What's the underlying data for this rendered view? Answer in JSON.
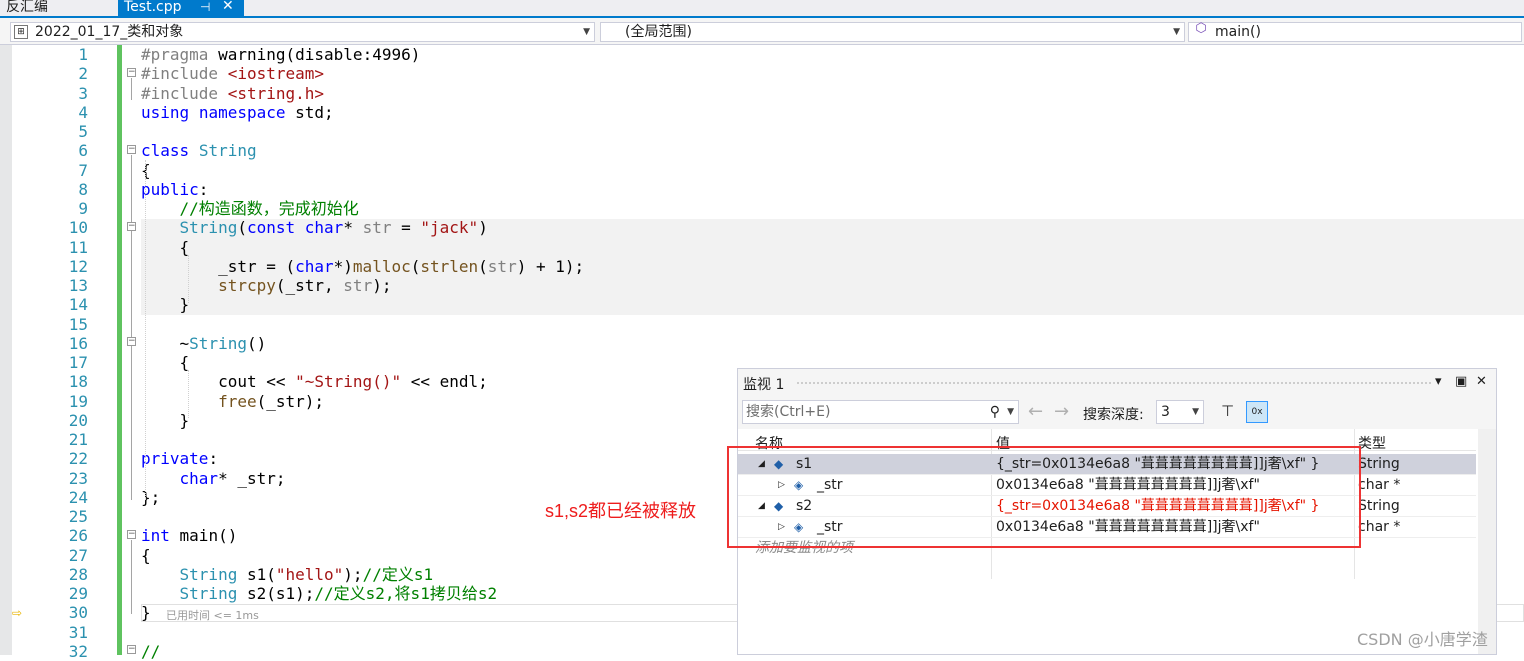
{
  "tabs": [
    {
      "label": "反汇编",
      "active": false
    },
    {
      "label": "Test.cpp",
      "active": true
    }
  ],
  "tab_pin_icon": "pin-icon",
  "tab_close_icon": "close-icon",
  "nav": {
    "project": "2022_01_17_类和对象",
    "scope": "(全局范围)",
    "member": "main()"
  },
  "editor": {
    "line_numbers": [
      "1",
      "2",
      "3",
      "4",
      "5",
      "6",
      "7",
      "8",
      "9",
      "10",
      "11",
      "12",
      "13",
      "14",
      "15",
      "16",
      "17",
      "18",
      "19",
      "20",
      "21",
      "22",
      "23",
      "24",
      "25",
      "26",
      "27",
      "28",
      "29",
      "30",
      "31",
      "32"
    ],
    "lines": [
      "#pragma warning(disable:4996)",
      "#include <iostream>",
      "#include <string.h>",
      "using namespace std;",
      "",
      "class String",
      "{",
      "public:",
      "    //构造函数，完成初始化",
      "    String(const char* str = \"jack\")",
      "    {",
      "        _str = (char*)malloc(strlen(str) + 1);",
      "        strcpy(_str, str);",
      "    }",
      "",
      "    ~String()",
      "    {",
      "        cout << \"~String()\" << endl;",
      "        free(_str);",
      "    }",
      "",
      "private:",
      "    char* _str;",
      "};",
      "",
      "int main()",
      "{",
      "    String s1(\"hello\");//定义s1",
      "    String s2(s1);//定义s2,将s1拷贝给s2",
      "}",
      "",
      "//"
    ],
    "elapsed": "已用时间 <= 1ms"
  },
  "annotation": "s1,s2都已经被释放",
  "watch": {
    "title": "监视 1",
    "search_placeholder": "搜索(Ctrl+E)",
    "depth_label": "搜索深度:",
    "depth_value": "3",
    "headers": {
      "name": "名称",
      "value": "值",
      "type": "类型"
    },
    "rows": [
      {
        "name": "s1",
        "value": "{_str=0x0134e6a8 \"葺葺葺葺葺葺葺葺]]j奢\\xf\" }",
        "type": "String",
        "level": 0,
        "expanded": true,
        "changed": false
      },
      {
        "name": "_str",
        "value": "0x0134e6a8 \"葺葺葺葺葺葺葺葺]]j奢\\xf\"",
        "type": "char *",
        "level": 1,
        "expanded": false,
        "changed": false
      },
      {
        "name": "s2",
        "value": "{_str=0x0134e6a8 \"葺葺葺葺葺葺葺葺]]j奢\\xf\" }",
        "type": "String",
        "level": 0,
        "expanded": true,
        "changed": true
      },
      {
        "name": "_str",
        "value": "0x0134e6a8 \"葺葺葺葺葺葺葺葺]]j奢\\xf\"",
        "type": "char *",
        "level": 1,
        "expanded": false,
        "changed": false
      }
    ],
    "add_watch": "添加要监视的项"
  },
  "watermark": "CSDN @小唐学渣"
}
